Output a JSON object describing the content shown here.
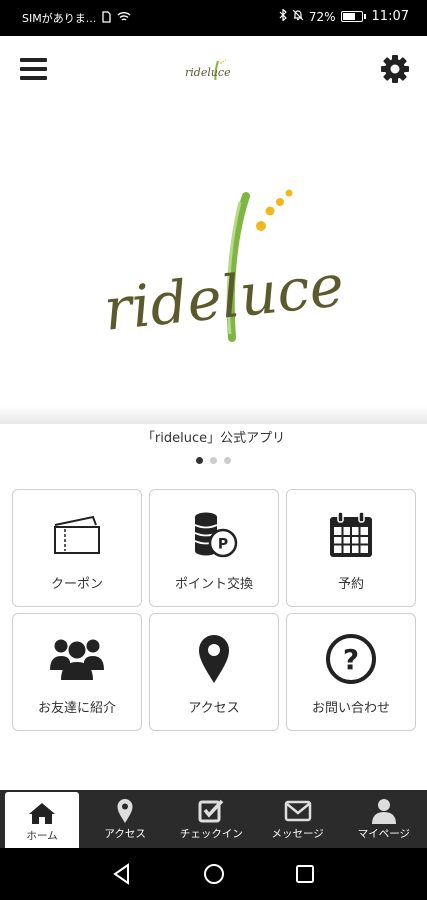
{
  "status_bar": {
    "carrier": "SIMがありま...",
    "battery": "72%",
    "battery_level": 0.72,
    "time": "11:07"
  },
  "header": {
    "logo_text": "rideluce"
  },
  "hero": {
    "logo_text": "rideluce",
    "caption": "「rideluce」公式アプリ",
    "slide_count": 3,
    "active_slide": 1
  },
  "menu": [
    {
      "label": "クーポン",
      "icon": "ticket-icon"
    },
    {
      "label": "ポイント交換",
      "icon": "coins-icon"
    },
    {
      "label": "予約",
      "icon": "calendar-icon"
    },
    {
      "label": "お友達に紹介",
      "icon": "people-icon"
    },
    {
      "label": "アクセス",
      "icon": "location-pin-icon"
    },
    {
      "label": "お問い合わせ",
      "icon": "question-icon"
    }
  ],
  "tabs": [
    {
      "label": "ホーム",
      "icon": "home-icon",
      "active": true
    },
    {
      "label": "アクセス",
      "icon": "location-pin-icon"
    },
    {
      "label": "チェックイン",
      "icon": "checkin-icon"
    },
    {
      "label": "メッセージ",
      "icon": "mail-icon"
    },
    {
      "label": "マイページ",
      "icon": "person-icon"
    }
  ],
  "colors": {
    "logo_olive": "#5a5a2c",
    "logo_green": "#7db640",
    "logo_yellow": "#f0b81b",
    "tabbar_bg": "#2b2b2b"
  }
}
